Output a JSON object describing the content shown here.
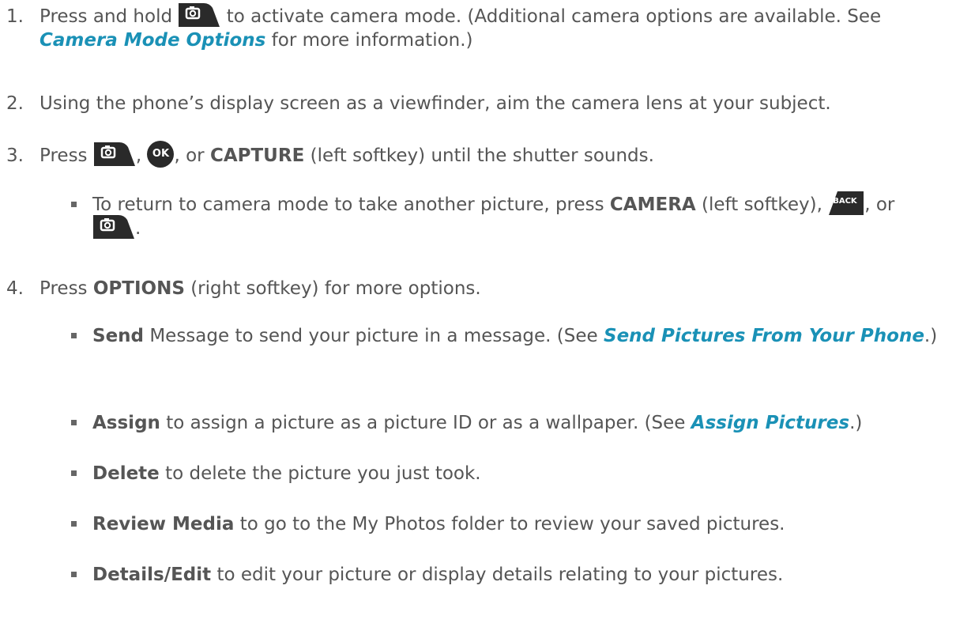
{
  "steps": [
    {
      "num": "1.",
      "t1": "Press and hold",
      "t2": "to activate camera mode. (Additional camera options are available. See",
      "link": "Camera Mode Options",
      "t3": "for more information.)"
    },
    {
      "num": "2.",
      "t1": "Using the phone’s display screen as a viewfinder, aim the camera lens at your subject."
    },
    {
      "num": "3.",
      "t1": "Press",
      "sep1": ",",
      "sep2": ", or",
      "bold": "CAPTURE",
      "t2": "(left softkey) until the shutter sounds.",
      "sub": {
        "t1": "To return to camera mode to take another picture, press",
        "bold": "CAMERA",
        "t2": "(left softkey),",
        "sep": ", or",
        "end": "."
      }
    },
    {
      "num": "4.",
      "t1": "Press",
      "bold": "OPTIONS",
      "t2": "(right softkey) for more options.",
      "bullets": [
        {
          "bold": "Send",
          "t1": "Message to send your picture in a message. (See",
          "link": "Send Pictures From Your Phone",
          "t2": ".)"
        },
        {
          "bold": "Assign",
          "t1": "to assign a picture as a picture ID or as a wallpaper. (See",
          "link": "Assign Pictures",
          "t2": ".)"
        },
        {
          "bold": "Delete",
          "t1": "to delete the picture you just took."
        },
        {
          "bold": "Review Media",
          "t1": "to go to the My Photos folder to review your saved pictures."
        },
        {
          "bold": "Details/Edit",
          "t1": "to edit your picture or display details relating to your pictures."
        }
      ]
    }
  ],
  "keys": {
    "ok_label": "OK",
    "back_label": "BACK"
  },
  "colors": {
    "text": "#555555",
    "link": "#1a91b6",
    "key_bg": "#2a2a2a"
  }
}
